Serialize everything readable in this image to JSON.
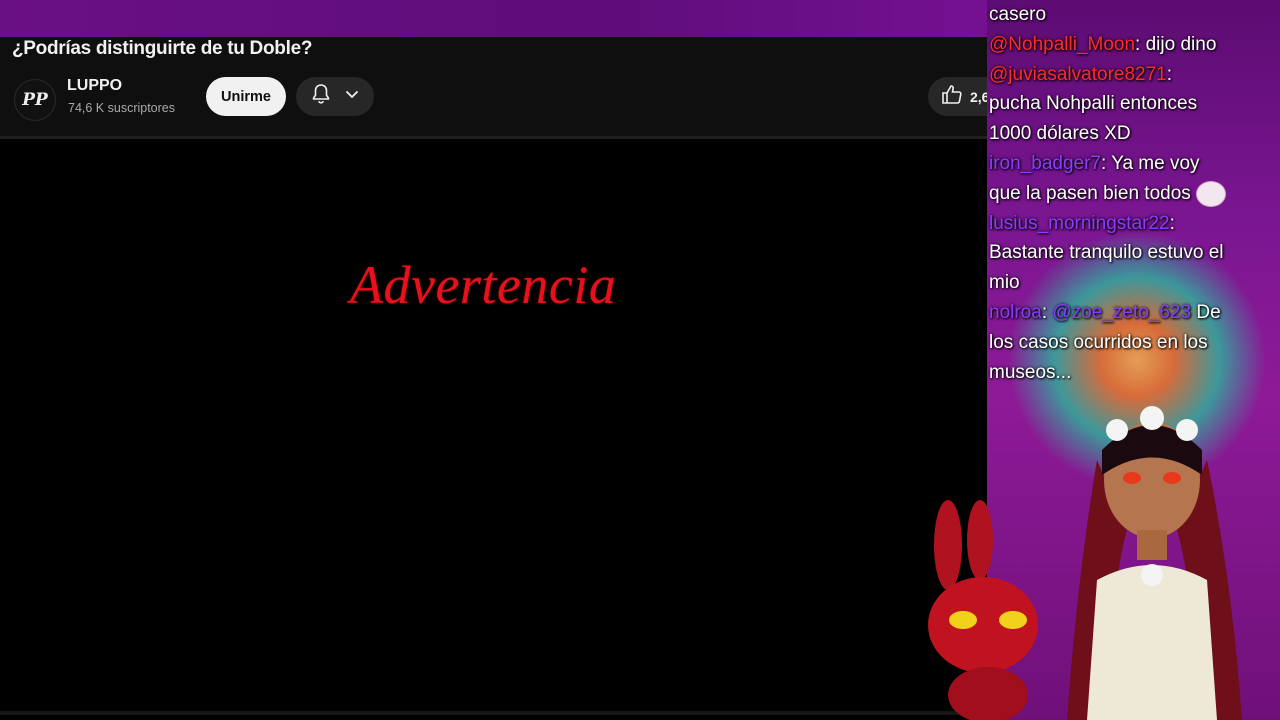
{
  "video": {
    "title": "¿Podrías distinguirte de tu Doble?",
    "channel": "LUPPO",
    "avatar_initials": "PP",
    "subscribers": "74,6 K suscriptores",
    "join_label": "Unirme",
    "like_count": "2,6",
    "warning_text": "Advertencia"
  },
  "icons": {
    "bell": "bell-icon",
    "chevron": "chevron-down-icon",
    "like": "thumbs-up-icon"
  },
  "colors": {
    "warning_red": "#e8111b",
    "username_red": "#ff2a2a",
    "username_purple": "#8a3dff",
    "overlay_purple": "#7a1691"
  },
  "chat": {
    "l1_text": "casero",
    "l2_user": "@Nohpalli_Moon",
    "l2_text": ": dijo dino",
    "l3_user": "@juviasalvatore8271",
    "l3_text": ":",
    "l4_text": "pucha Nohpalli entonces",
    "l5_text": "1000 dólares XD",
    "l6_user": "iron_badger7",
    "l6_text": ": Ya me voy",
    "l7_text": "que la pasen bien todos",
    "l8_user": "lusius_morningstar22",
    "l8_text": ":",
    "l9_text": "Bastante tranquilo estuvo el",
    "l10_text": "mio",
    "l11_user": "nolroa",
    "l11_mention": "@zoe_zeto_623",
    "l11_text": " De",
    "l12_text": "los casos ocurridos en los",
    "l13_text": "museos..."
  }
}
